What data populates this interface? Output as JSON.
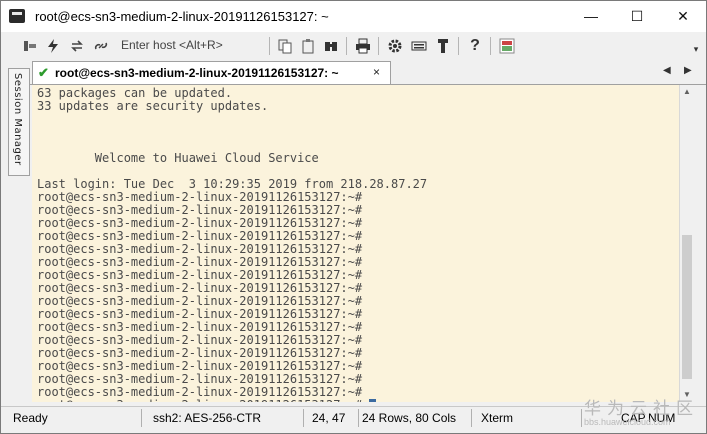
{
  "window": {
    "title": "root@ecs-sn3-medium-2-linux-20191126153127: ~",
    "minimize": "—",
    "maximize": "☐",
    "close": "✕"
  },
  "toolbar": {
    "enter_host_label": "Enter host <Alt+R>",
    "icons": [
      "connect-icon",
      "quick-connect-icon",
      "reconnect-icon",
      "disconnect-icon",
      "copy-icon",
      "paste-icon",
      "find-icon",
      "print-icon",
      "options-icon",
      "keymap-icon",
      "sftp-icon",
      "help-icon",
      "extra-icon"
    ]
  },
  "sidebar": {
    "label": "Session Manager"
  },
  "tab": {
    "label": "root@ecs-sn3-medium-2-linux-20191126153127: ~",
    "close": "×",
    "nav_left": "◀",
    "nav_right": "▶"
  },
  "terminal": {
    "lines": [
      "63 packages can be updated.",
      "33 updates are security updates.",
      "",
      "",
      "",
      "        Welcome to Huawei Cloud Service",
      "",
      "Last login: Tue Dec  3 10:29:35 2019 from 218.28.87.27",
      "root@ecs-sn3-medium-2-linux-20191126153127:~#",
      "root@ecs-sn3-medium-2-linux-20191126153127:~#",
      "root@ecs-sn3-medium-2-linux-20191126153127:~#",
      "root@ecs-sn3-medium-2-linux-20191126153127:~#",
      "root@ecs-sn3-medium-2-linux-20191126153127:~#",
      "root@ecs-sn3-medium-2-linux-20191126153127:~#",
      "root@ecs-sn3-medium-2-linux-20191126153127:~#",
      "root@ecs-sn3-medium-2-linux-20191126153127:~#",
      "root@ecs-sn3-medium-2-linux-20191126153127:~#",
      "root@ecs-sn3-medium-2-linux-20191126153127:~#",
      "root@ecs-sn3-medium-2-linux-20191126153127:~#",
      "root@ecs-sn3-medium-2-linux-20191126153127:~#",
      "root@ecs-sn3-medium-2-linux-20191126153127:~#",
      "root@ecs-sn3-medium-2-linux-20191126153127:~#",
      "root@ecs-sn3-medium-2-linux-20191126153127:~#",
      "root@ecs-sn3-medium-2-linux-20191126153127:~#",
      "root@ecs-sn3-medium-2-linux-20191126153127:~# "
    ]
  },
  "status": {
    "ready": "Ready",
    "cipher": "ssh2: AES-256-CTR",
    "position": "24,  47",
    "size": "24 Rows, 80 Cols",
    "term_type": "Xterm",
    "cap": "CAP",
    "num": "NUM"
  },
  "watermark": {
    "line1": "华为云社区",
    "line2": "bbs.huaweicloud.com"
  },
  "colors": {
    "terminal_bg": "#fbf3dc",
    "terminal_fg": "#4a4a4a",
    "cursor": "#3b6aa0",
    "tab_check": "#2e9b2e"
  }
}
